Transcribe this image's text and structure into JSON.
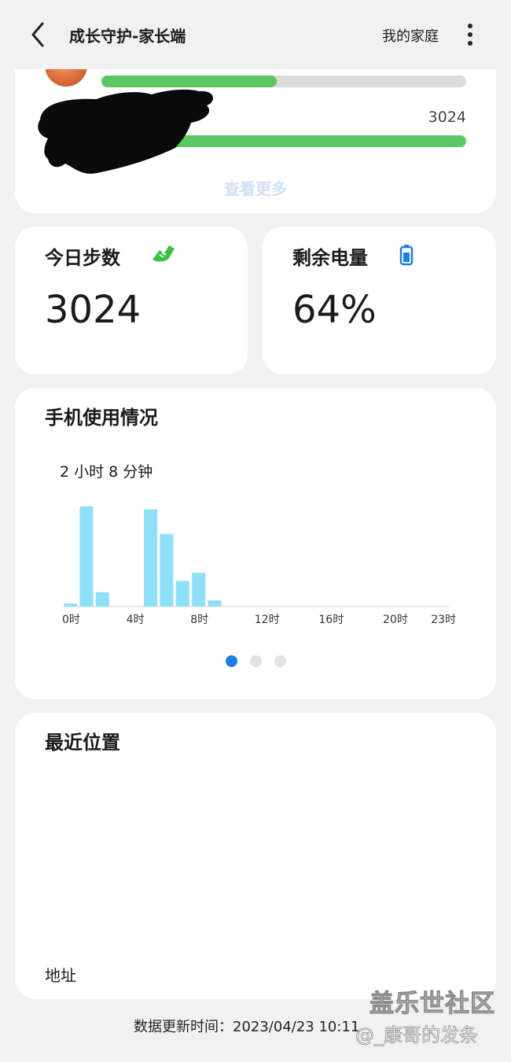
{
  "header": {
    "title": "成长守护-家长端",
    "family_label": "我的家庭"
  },
  "summary_card": {
    "bar1_progress": 0.48,
    "bar2_value": "3024",
    "bar2_progress": 1.0,
    "see_more": "查看更多"
  },
  "steps": {
    "label": "今日步数",
    "value": "3024",
    "icon": "running-shoe-icon"
  },
  "battery": {
    "label": "剩余电量",
    "value": "64%",
    "icon": "battery-icon"
  },
  "usage": {
    "title": "手机使用情况",
    "total": "2 小时 8 分钟",
    "pages": 3,
    "active_page": 0,
    "chart_data": {
      "type": "bar",
      "x": [
        0,
        1,
        2,
        5,
        6,
        7,
        8,
        9
      ],
      "y": [
        3,
        98,
        14,
        95,
        71,
        25,
        33,
        6
      ],
      "xlim": [
        0,
        23
      ],
      "x_tick_labels": [
        "0时",
        "4时",
        "8时",
        "12时",
        "16时",
        "20时",
        "23时"
      ],
      "x_tick_values": [
        0,
        4,
        8,
        12,
        16,
        20,
        23
      ],
      "color": "#8ee0f8"
    }
  },
  "location": {
    "title": "最近位置",
    "address_label": "地址"
  },
  "footer": {
    "updated": "数据更新时间：2023/04/23 10:11"
  },
  "watermark": {
    "line1": "盖乐世社区",
    "line2": "@_康哥的发条"
  },
  "colors": {
    "accent_green": "#5cc864",
    "accent_blue": "#1a7fe6",
    "bar_cyan": "#8ee0f8"
  }
}
